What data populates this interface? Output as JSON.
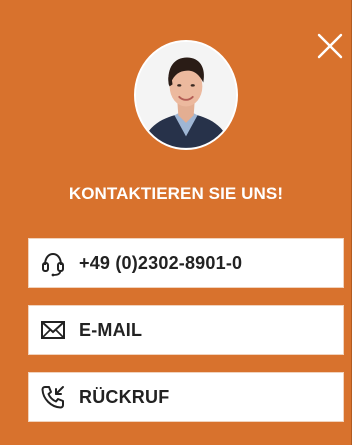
{
  "colors": {
    "panel_background": "#d8722d",
    "button_background": "#ffffff",
    "text_on_panel": "#ffffff",
    "button_text": "#222222"
  },
  "header": {
    "close_icon": "close-icon"
  },
  "contact": {
    "avatar": "avatar",
    "headline": "KONTAKTIEREN SIE UNS!"
  },
  "actions": [
    {
      "icon": "headset-icon",
      "label": "+49 (0)2302-8901-0"
    },
    {
      "icon": "envelope-icon",
      "label": "E-MAIL"
    },
    {
      "icon": "callback-phone-icon",
      "label": "RÜCKRUF"
    }
  ]
}
